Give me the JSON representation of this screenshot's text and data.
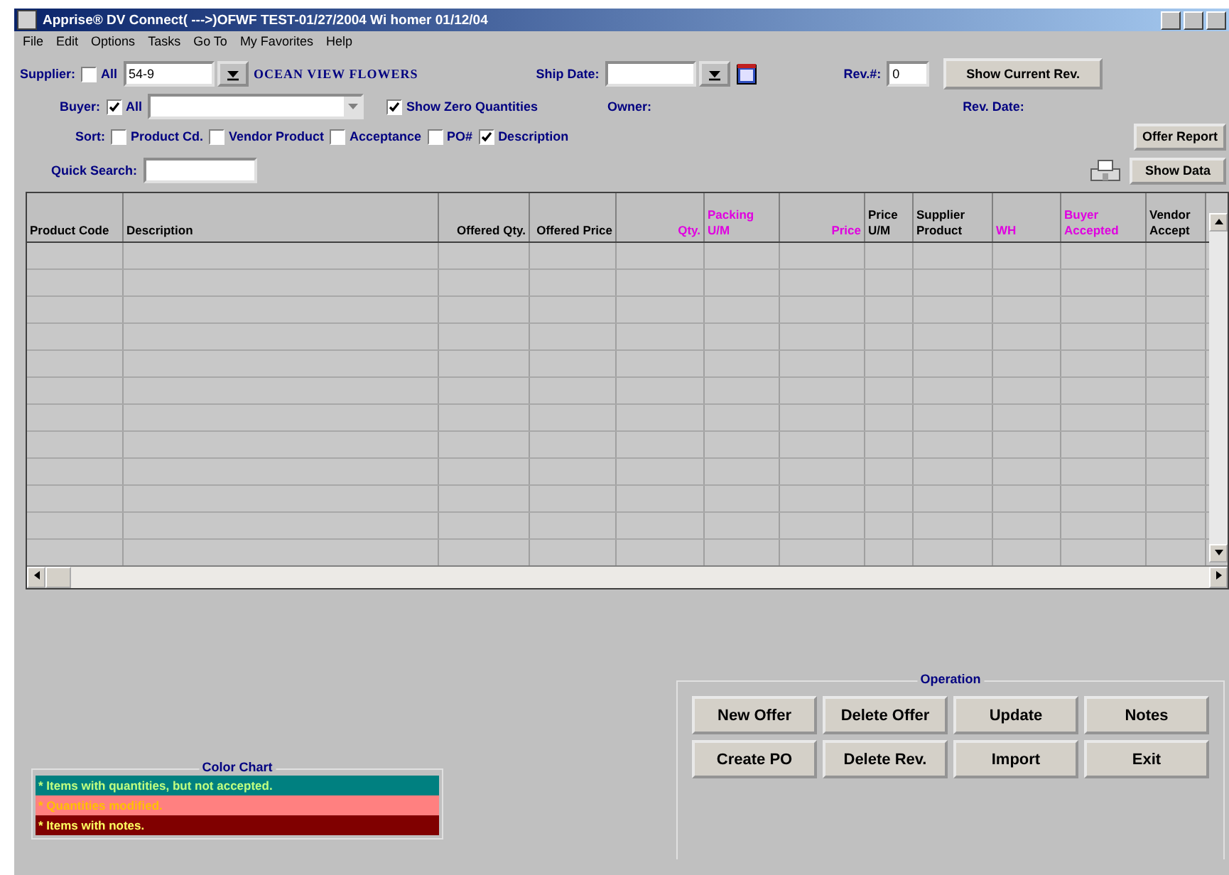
{
  "window": {
    "title": "Apprise® DV Connect( --->)OFWF TEST-01/27/2004 Wi homer 01/12/04"
  },
  "menu": [
    "File",
    "Edit",
    "Options",
    "Tasks",
    "Go To",
    "My Favorites",
    "Help"
  ],
  "supplier": {
    "label": "Supplier:",
    "all_label": "All",
    "all_checked": false,
    "code": "54-9",
    "name": "OCEAN VIEW FLOWERS"
  },
  "ship_date": {
    "label": "Ship Date:"
  },
  "rev": {
    "label": "Rev.#:",
    "value": "0"
  },
  "show_current_rev": "Show Current Rev.",
  "buyer": {
    "label": "Buyer:",
    "all_label": "All",
    "all_checked": true
  },
  "show_zero": {
    "label": "Show Zero Quantities",
    "checked": true
  },
  "owner_label": "Owner:",
  "rev_date_label": "Rev. Date:",
  "sort": {
    "label": "Sort:",
    "options": [
      {
        "label": "Product Cd.",
        "selected": false
      },
      {
        "label": "Vendor Product",
        "selected": false
      },
      {
        "label": "Acceptance",
        "selected": false
      },
      {
        "label": "PO#",
        "selected": false
      },
      {
        "label": "Description",
        "selected": true
      }
    ]
  },
  "offer_report": "Offer Report",
  "quick_search": {
    "label": "Quick Search:"
  },
  "show_data": "Show Data",
  "table": {
    "columns": [
      {
        "label": "Product Code",
        "kind": "text",
        "color": "#000000"
      },
      {
        "label": "Description",
        "kind": "text",
        "color": "#000000"
      },
      {
        "label": "Offered Qty.",
        "kind": "number",
        "color": "#000000"
      },
      {
        "label": "Offered Price",
        "kind": "number",
        "color": "#000000"
      },
      {
        "label": "Qty.",
        "kind": "number",
        "color": "#e000e0"
      },
      {
        "label": "Packing U/M",
        "kind": "text",
        "color": "#e000e0"
      },
      {
        "label": "Price",
        "kind": "number",
        "color": "#e000e0"
      },
      {
        "label": "Price U/M",
        "kind": "text",
        "color": "#000000"
      },
      {
        "label": "Supplier Product",
        "kind": "text",
        "color": "#000000"
      },
      {
        "label": "WH",
        "kind": "text",
        "color": "#e000e0"
      },
      {
        "label": "Buyer Accepted",
        "kind": "text",
        "color": "#e000e0"
      },
      {
        "label": "Vendor Accept",
        "kind": "text",
        "color": "#000000"
      }
    ]
  },
  "color_chart": {
    "title": "Color Chart",
    "items": [
      {
        "text": "* Items with quantities, but not accepted.",
        "color": "#008080"
      },
      {
        "text": "* Quantities modified.",
        "color": "#ff8080"
      },
      {
        "text": "* Items with notes.",
        "color": "#800000"
      }
    ]
  },
  "operation": {
    "title": "Operation",
    "buttons": [
      "New Offer",
      "Delete Offer",
      "Update",
      "Notes",
      "Create PO",
      "Delete Rev.",
      "Import",
      "Exit"
    ]
  }
}
